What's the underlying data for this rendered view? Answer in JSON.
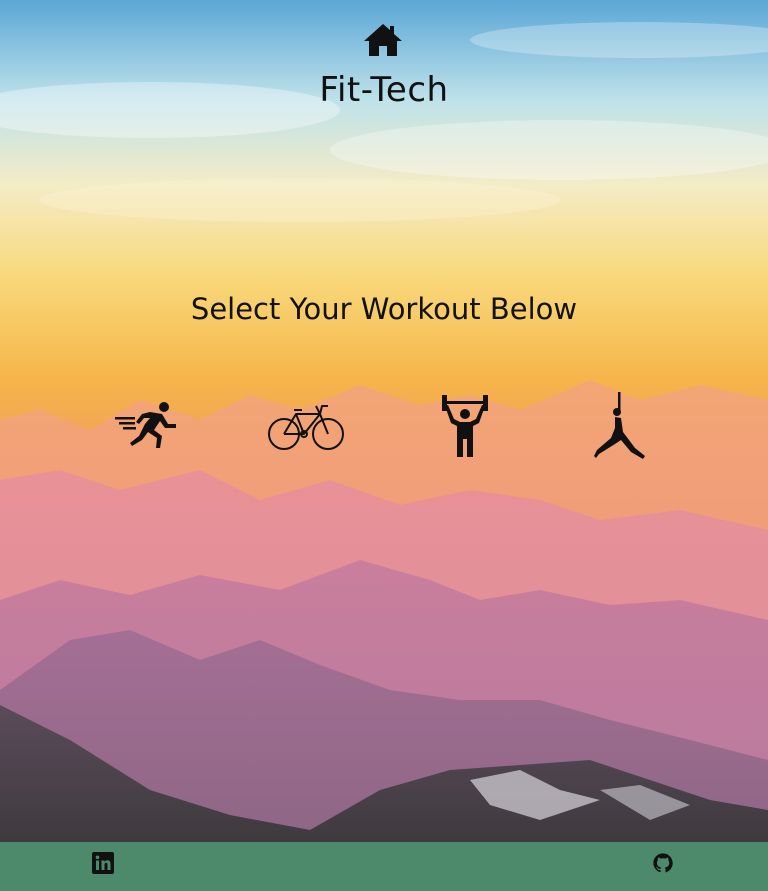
{
  "header": {
    "home_icon": "home-icon",
    "brand": "Fit-Tech"
  },
  "main": {
    "subtitle": "Select Your Workout Below",
    "workouts": [
      {
        "icon": "running-icon"
      },
      {
        "icon": "bicycle-icon"
      },
      {
        "icon": "weightlifting-icon"
      },
      {
        "icon": "yoga-icon"
      }
    ]
  },
  "footer": {
    "background": "#4d8a6c",
    "links": [
      {
        "icon": "linkedin-icon"
      },
      {
        "icon": "github-icon"
      }
    ]
  }
}
